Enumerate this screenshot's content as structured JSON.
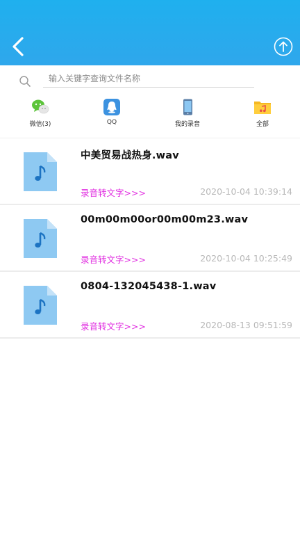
{
  "header": {
    "back_icon": "chevron-left-icon",
    "upload_icon": "upload-circle-icon",
    "color": "#2aaaed"
  },
  "search": {
    "placeholder": "输入关键字查询文件名称",
    "value": "",
    "icon": "search-icon"
  },
  "sources": [
    {
      "label": "微信(3)",
      "icon": "wechat-icon"
    },
    {
      "label": "QQ",
      "icon": "qq-icon"
    },
    {
      "label": "我的录音",
      "icon": "phone-icon"
    },
    {
      "label": "全部",
      "icon": "folder-music-icon"
    }
  ],
  "files": [
    {
      "name": "中美贸易战热身.wav",
      "action": "录音转文字>>>",
      "date": "2020-10-04 10:39:14"
    },
    {
      "name": "00m00m00or00m00m23.wav",
      "action": "录音转文字>>>",
      "date": "2020-10-04 10:25:49"
    },
    {
      "name": "0804-132045438-1.wav",
      "action": "录音转文字>>>",
      "date": "2020-08-13 09:51:59"
    }
  ],
  "colors": {
    "accent": "#2aaaed",
    "action_link": "#e02de0",
    "date_text": "#b8b8b8",
    "file_icon": "#8ec9f2"
  }
}
